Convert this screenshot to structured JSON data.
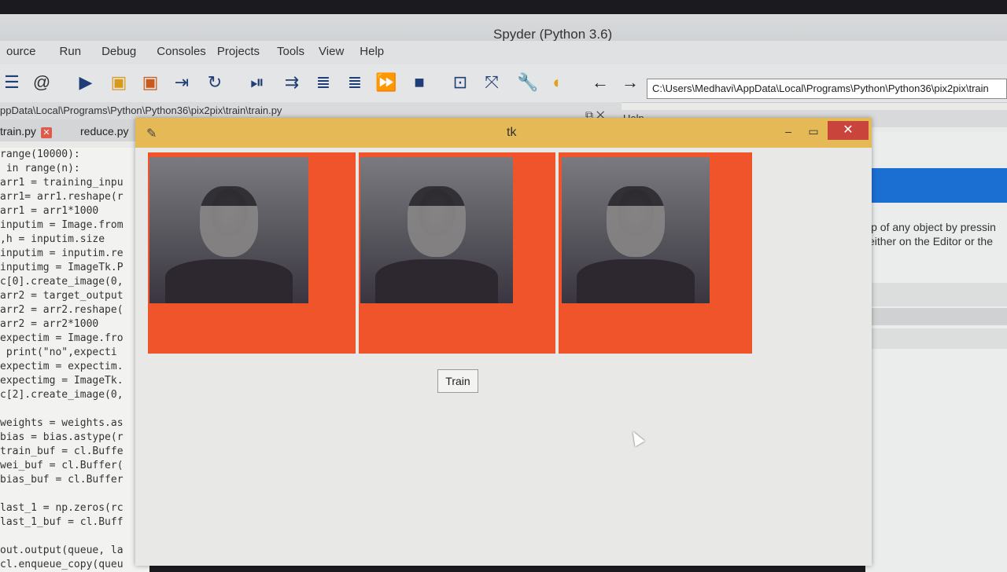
{
  "spyder": {
    "title": "Spyder (Python 3.6)",
    "menu": [
      "ource",
      "Run",
      "Debug",
      "Consoles",
      "Projects",
      "Tools",
      "View",
      "Help"
    ],
    "path_box": "C:\\Users\\Medhavi\\AppData\\Local\\Programs\\Python\\Python36\\pix2pix\\train",
    "file_path": "ppData\\Local\\Programs\\Python\\Python36\\pix2pix\\train\\train.py",
    "editor_tabs": [
      "train.py",
      "reduce.py"
    ],
    "help_tab": "Help",
    "help_text": "lp of any object by pressin either on the Editor or the",
    "code_lines": [
      "range(10000):",
      " in range(n):",
      "arr1 = training_inpu",
      "arr1= arr1.reshape(r",
      "arr1 = arr1*1000",
      "inputim = Image.from",
      ",h = inputim.size",
      "inputim = inputim.re",
      "inputimg = ImageTk.P",
      "c[0].create_image(0,",
      "arr2 = target_output",
      "arr2 = arr2.reshape(",
      "arr2 = arr2*1000",
      "expectim = Image.fro",
      " print(\"no\",expecti",
      "expectim = expectim.",
      "expectimg = ImageTk.",
      "c[2].create_image(0,",
      "",
      "weights = weights.as",
      "bias = bias.astype(r",
      "train_buf = cl.Buffe",
      "wei_buf = cl.Buffer(",
      "bias_buf = cl.Buffer",
      "",
      "last_1 = np.zeros(rc",
      "last_1_buf = cl.Buff",
      "",
      "out.output(queue, la",
      "cl.enqueue_copy(queu"
    ]
  },
  "tk": {
    "title": "tk",
    "train_label": "Train"
  }
}
